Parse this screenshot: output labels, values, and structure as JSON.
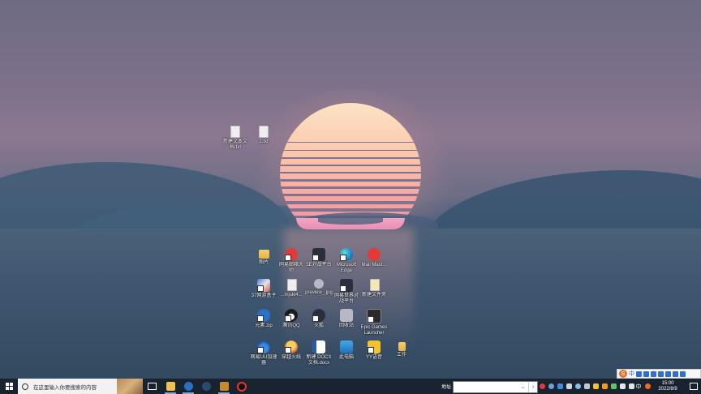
{
  "desktop": {
    "row1": [
      {
        "label": "新建文本文档.txt",
        "icon": "text-file-icon"
      },
      {
        "label": "1.txt",
        "icon": "text-file-icon"
      }
    ],
    "icons": [
      {
        "label": "图片",
        "icon": "folder-icon"
      },
      {
        "label": "网易邮箱大师",
        "icon": "mail-master-icon"
      },
      {
        "label": "5E对战平台",
        "icon": "5e-platform-icon"
      },
      {
        "label": "Microsoft Edge",
        "icon": "edge-icon"
      },
      {
        "label": "Mail Mast...",
        "icon": "mail-master-icon"
      },
      {
        "label": "37网游盒子",
        "icon": "game-box-icon"
      },
      {
        "label": "...mjskl4...",
        "icon": "file-icon"
      },
      {
        "label": "preview_.jpg",
        "icon": "image-file-icon"
      },
      {
        "label": "网易世界对战平台",
        "icon": "netease-platform-icon"
      },
      {
        "label": "新建文件夹",
        "icon": "folder-icon"
      },
      {
        "label": "元素.zip",
        "icon": "zip-icon"
      },
      {
        "label": "腾讯QQ",
        "icon": "qq-icon"
      },
      {
        "label": "火狐",
        "icon": "browser-icon"
      },
      {
        "label": "回收站",
        "icon": "recycle-bin-icon"
      },
      {
        "label": "Epic Games Launcher",
        "icon": "epic-games-icon"
      },
      {
        "label": "网易UU加速器",
        "icon": "uu-accelerator-icon"
      },
      {
        "label": "穿越火线",
        "icon": "crossfire-icon"
      },
      {
        "label": "新建 DOCX 文档.docx",
        "icon": "word-file-icon"
      },
      {
        "label": "此电脑",
        "icon": "computer-icon"
      },
      {
        "label": "YY语音",
        "icon": "yy-voice-icon"
      },
      {
        "label": "工作",
        "icon": "folder-icon"
      }
    ]
  },
  "taskbar": {
    "search_placeholder": "在这里输入你要搜索的内容",
    "address_label": "地址",
    "address_value": "",
    "clock_time": "15:00",
    "clock_date": "2022/8/9",
    "lang": "中",
    "pinned": [
      "file-explorer-icon",
      "browser-icon",
      "steam-icon",
      "game-icon",
      "obs-icon"
    ]
  },
  "ime": {
    "logo": "S",
    "lang": "中"
  },
  "colors": {
    "taskbar": "#18232f",
    "sun_top": "#fde3c6",
    "sun_bottom": "#f08ca5"
  }
}
